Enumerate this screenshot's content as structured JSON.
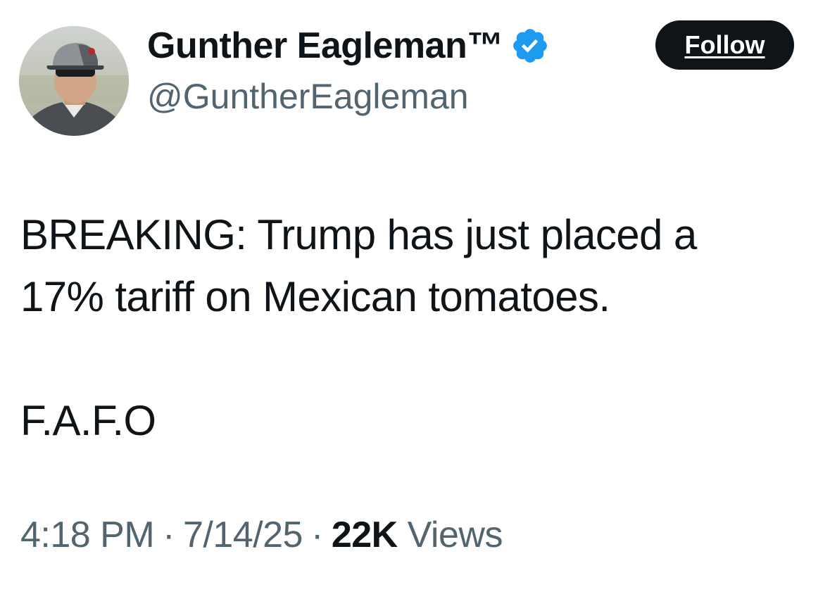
{
  "author": {
    "display_name": "Gunther Eagleman™",
    "handle": "@GuntherEagleman",
    "verified_icon": "verified-badge-icon",
    "avatar": "profile-photo"
  },
  "actions": {
    "follow_label": "Follow"
  },
  "tweet": {
    "lines": [
      "BREAKING: Trump has just placed a",
      "17% tariff on Mexican tomatoes."
    ],
    "closing": "F.A.F.O"
  },
  "meta": {
    "time": "4:18 PM",
    "separator": "·",
    "date": "7/14/25",
    "views_count": "22K",
    "views_label": "Views"
  },
  "colors": {
    "text_primary": "#0f1419",
    "text_secondary": "#536471",
    "verified_blue": "#1d9bf0",
    "button_bg": "#0f1419"
  }
}
